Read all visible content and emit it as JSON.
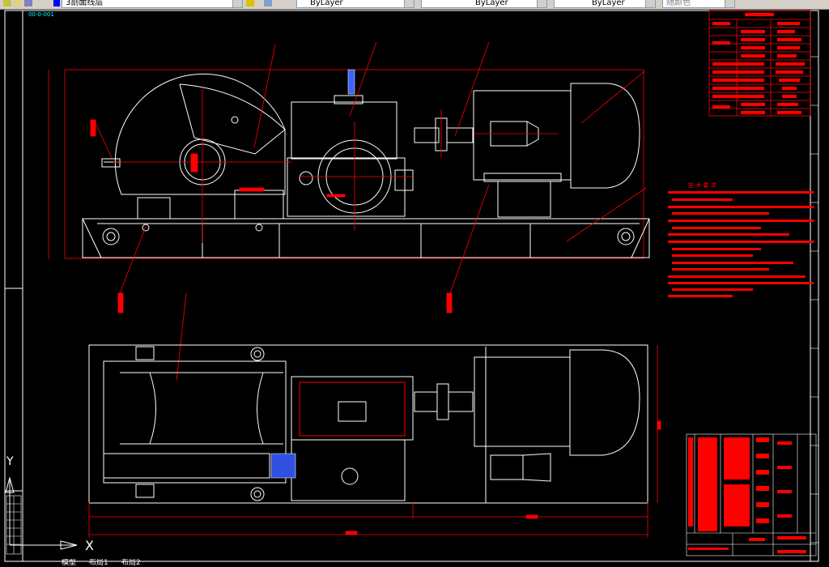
{
  "toolbar": {
    "layer_name": "3剖面线层",
    "color_control": "ByLayer",
    "linetype_control": "ByLayer",
    "lineweight_control": "ByLayer",
    "plotstyle_control": "随颜色"
  },
  "page_label": "00-0-001",
  "ucs": {
    "x_label": "X",
    "y_label": "Y"
  },
  "layout_tabs": {
    "model": "模型",
    "layout1": "布局1",
    "layout2": "布局2"
  },
  "tech_notes_title": "技 术 要 求",
  "colors": {
    "background": "#000000",
    "line_white": "#ffffff",
    "annotation_red": "#ff0000",
    "accent_blue": "#4060ff",
    "toolbar_gray": "#d4d0c8"
  }
}
